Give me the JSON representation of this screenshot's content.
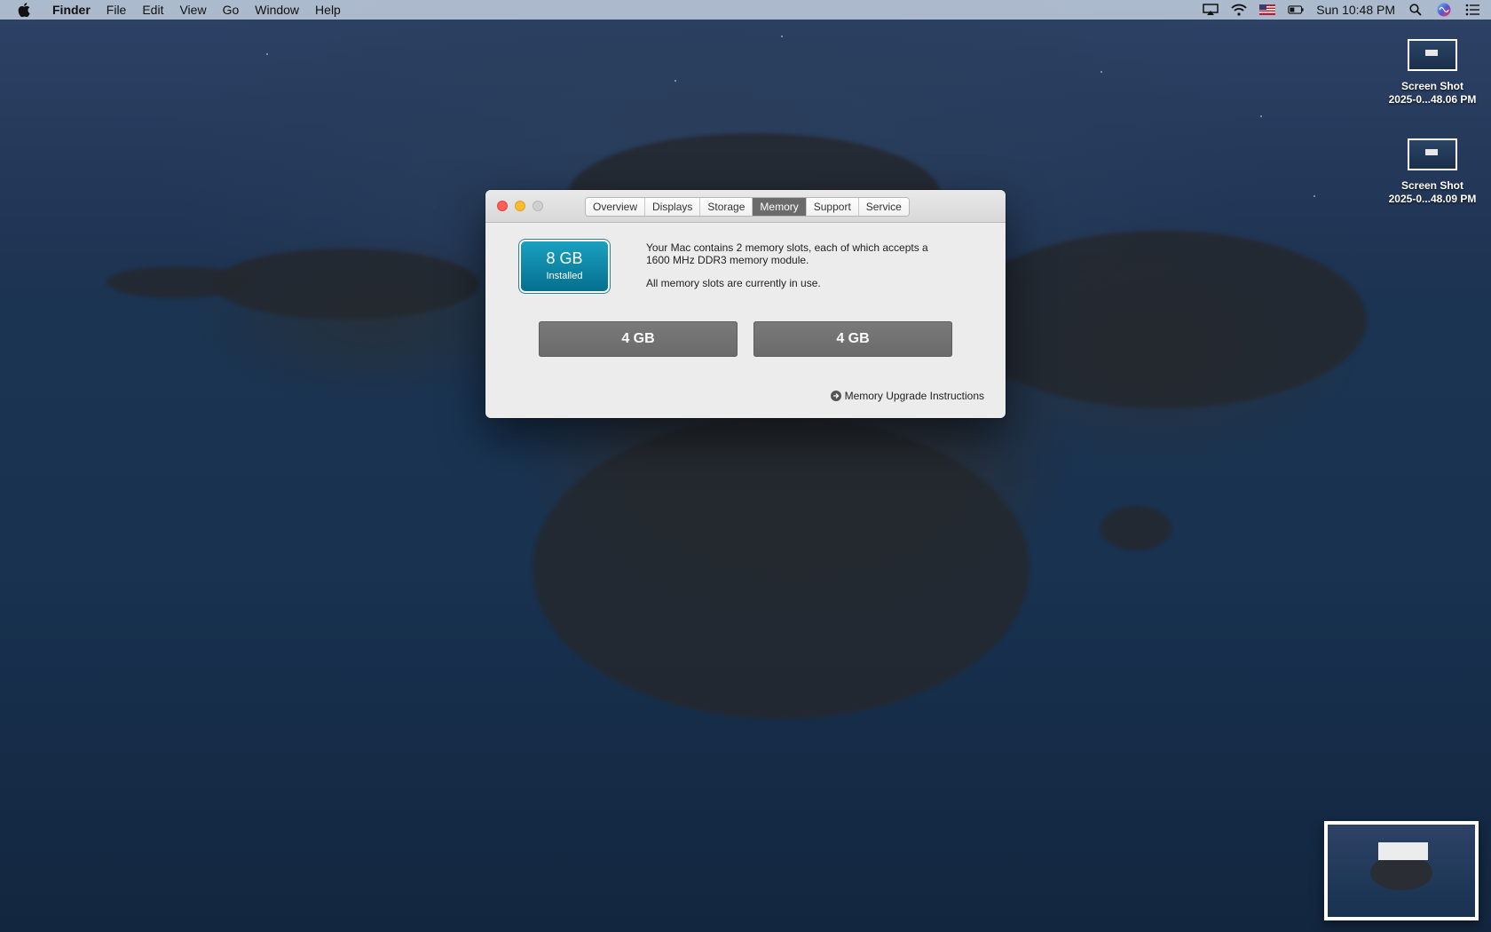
{
  "menubar": {
    "app_name": "Finder",
    "menus": [
      "File",
      "Edit",
      "View",
      "Go",
      "Window",
      "Help"
    ],
    "clock": "Sun 10:48 PM"
  },
  "desktop": {
    "icons": [
      {
        "line1": "Screen Shot",
        "line2": "2025-0...48.06 PM"
      },
      {
        "line1": "Screen Shot",
        "line2": "2025-0...48.09 PM"
      }
    ]
  },
  "window": {
    "tabs": [
      "Overview",
      "Displays",
      "Storage",
      "Memory",
      "Support",
      "Service"
    ],
    "active_tab": "Memory",
    "badge": {
      "amount": "8 GB",
      "label": "Installed"
    },
    "description": [
      "Your Mac contains 2 memory slots, each of which accepts a 1600 MHz DDR3 memory module.",
      "All memory slots are currently in use."
    ],
    "slots": [
      "4 GB",
      "4 GB"
    ],
    "upgrade_link": "Memory Upgrade Instructions"
  },
  "colors": {
    "badge_accent": "#0a84a8",
    "active_tab": "#6b6b6b",
    "close_light": "#fc5f57",
    "minimize_light": "#fdbc2e"
  }
}
